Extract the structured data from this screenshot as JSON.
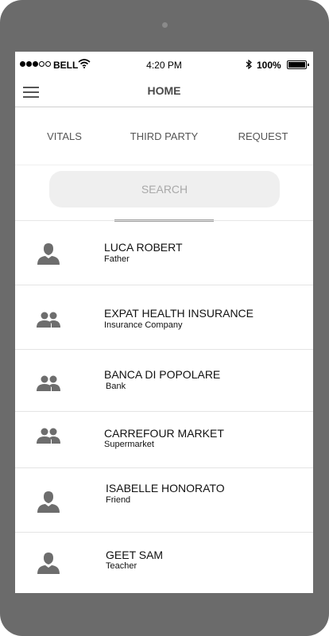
{
  "status_bar": {
    "carrier": "BELL",
    "time": "4:20 PM",
    "battery": "100%"
  },
  "header": {
    "title": "HOME",
    "menu_icon": "hamburger-menu-icon"
  },
  "tabs": [
    {
      "label": "VITALS",
      "active": false
    },
    {
      "label": "THIRD PARTY",
      "active": true
    },
    {
      "label": "REQUEST",
      "active": false
    }
  ],
  "search": {
    "placeholder": "SEARCH",
    "value": ""
  },
  "contacts": [
    {
      "name": "LUCA ROBERT",
      "relation": "Father",
      "icon": "person-icon"
    },
    {
      "name": "EXPAT HEALTH INSURANCE",
      "relation": "Insurance Company",
      "icon": "group-icon"
    },
    {
      "name": "BANCA DI POPOLARE",
      "relation": "Bank",
      "icon": "group-icon"
    },
    {
      "name": "CARREFOUR MARKET",
      "relation": "Supermarket",
      "icon": "group-icon"
    },
    {
      "name": "ISABELLE HONORATO",
      "relation": "Friend",
      "icon": "person-icon"
    },
    {
      "name": "GEET SAM",
      "relation": "Teacher",
      "icon": "person-icon"
    }
  ],
  "colors": {
    "device_frame": "#6b6b6b",
    "icon_gray": "#6d6d6d",
    "tab_indicator": "#9e9e9e",
    "search_bg": "#efefef"
  }
}
